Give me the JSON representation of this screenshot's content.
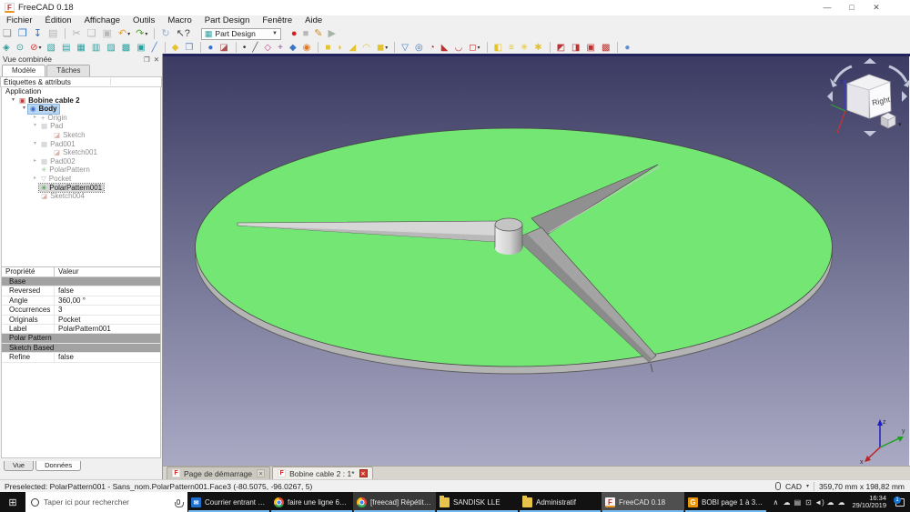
{
  "window": {
    "title": "FreeCAD 0.18",
    "minimize": "—",
    "maximize": "□",
    "close": "✕"
  },
  "menu": [
    "Fichier",
    "Édition",
    "Affichage",
    "Outils",
    "Macro",
    "Part Design",
    "Fenêtre",
    "Aide"
  ],
  "toolbar1": {
    "items": [
      {
        "name": "new-file-button",
        "glyph": "❏",
        "color": "#8a8a8a"
      },
      {
        "name": "open-file-button",
        "glyph": "❒",
        "color": "#3a76c4"
      },
      {
        "name": "save-button",
        "glyph": "↧",
        "color": "#2f6fc0"
      },
      {
        "name": "print-button",
        "glyph": "▤",
        "color": "#b5b5b5"
      },
      {
        "name": "separator",
        "sep": "true",
        "inter": "false"
      },
      {
        "name": "cut-button",
        "glyph": "✂",
        "color": "#b0b0b0"
      },
      {
        "name": "copy-button",
        "glyph": "❑",
        "color": "#b8b8b8"
      },
      {
        "name": "paste-button",
        "glyph": "▣",
        "color": "#b8b8b8"
      },
      {
        "name": "undo-button",
        "glyph": "↶",
        "color": "#e0a030",
        "caret": "▾"
      },
      {
        "name": "redo-button",
        "glyph": "↷",
        "color": "#4fa52f",
        "caret": "▾"
      },
      {
        "name": "separator",
        "sep": "true",
        "inter": "false"
      },
      {
        "name": "refresh-button",
        "glyph": "↻",
        "color": "#9ab0cc"
      },
      {
        "name": "whats-this-button",
        "glyph": "↖?",
        "color": "#444444"
      }
    ],
    "workbench": {
      "icon": "▦",
      "label": "Part Design",
      "caret": "▼"
    },
    "macro_items": [
      {
        "name": "macro-record-button",
        "glyph": "●",
        "color": "#d42020"
      },
      {
        "name": "macro-stop-button",
        "glyph": "■",
        "color": "#b8b8b8"
      },
      {
        "name": "macro-edit-button",
        "glyph": "✎",
        "color": "#d08a28"
      },
      {
        "name": "macro-play-button",
        "glyph": "▶",
        "color": "#a8b4a8"
      }
    ]
  },
  "toolbar2": {
    "items": [
      {
        "name": "fit-all-button",
        "glyph": "◈",
        "color": "#2b9898"
      },
      {
        "name": "zoom-button",
        "glyph": "⊙",
        "color": "#2b9898"
      },
      {
        "name": "draw-style-button",
        "glyph": "⊘",
        "color": "#d03030",
        "caret": "▾"
      },
      {
        "name": "view-isometric-button",
        "glyph": "▧",
        "color": "#2aa0a0"
      },
      {
        "name": "view-front-button",
        "glyph": "▤",
        "color": "#2aa0a0"
      },
      {
        "name": "view-top-button",
        "glyph": "▦",
        "color": "#2aa0a0"
      },
      {
        "name": "view-right-button",
        "glyph": "▥",
        "color": "#2aa0a0"
      },
      {
        "name": "view-rear-button",
        "glyph": "▨",
        "color": "#2aa0a0"
      },
      {
        "name": "view-bottom-button",
        "glyph": "▩",
        "color": "#2aa0a0"
      },
      {
        "name": "view-left-button",
        "glyph": "▣",
        "color": "#2aa0a0"
      },
      {
        "name": "measure-button",
        "glyph": "╱",
        "color": "#3f7fd0"
      },
      {
        "name": "separator",
        "sep": "true",
        "inter": "false"
      },
      {
        "name": "create-part-button",
        "glyph": "◆",
        "color": "#e3c330"
      },
      {
        "name": "create-group-button",
        "glyph": "❒",
        "color": "#6b86b8"
      },
      {
        "name": "separator",
        "sep": "true",
        "inter": "false"
      },
      {
        "name": "create-body-button",
        "glyph": "●",
        "color": "#3a6ed0"
      },
      {
        "name": "create-sketch-button",
        "glyph": "◪",
        "color": "#b05050"
      },
      {
        "name": "separator",
        "sep": "true",
        "inter": "false"
      },
      {
        "name": "datum-point-button",
        "glyph": "•",
        "color": "#333333"
      },
      {
        "name": "datum-line-button",
        "glyph": "╱",
        "color": "#555555"
      },
      {
        "name": "datum-plane-button",
        "glyph": "◇",
        "color": "#c04080"
      },
      {
        "name": "local-cs-button",
        "glyph": "+",
        "color": "#885588"
      },
      {
        "name": "shape-binder-button",
        "glyph": "◆",
        "color": "#3a76c4"
      },
      {
        "name": "clone-button",
        "glyph": "◉",
        "color": "#e07820"
      },
      {
        "name": "separator",
        "sep": "true",
        "inter": "false"
      },
      {
        "name": "pad-button",
        "glyph": "■",
        "color": "#e3c330"
      },
      {
        "name": "revolution-button",
        "glyph": "◗",
        "color": "#e3c330"
      },
      {
        "name": "additive-loft-button",
        "glyph": "◢",
        "color": "#e3c330"
      },
      {
        "name": "additive-pipe-button",
        "glyph": "◠",
        "color": "#e3c330"
      },
      {
        "name": "additive-primitive-button",
        "glyph": "◼",
        "color": "#e3c330",
        "caret": "▾"
      },
      {
        "name": "separator",
        "sep": "true",
        "inter": "false"
      },
      {
        "name": "pocket-button",
        "glyph": "▽",
        "color": "#3a76c4"
      },
      {
        "name": "hole-button",
        "glyph": "◎",
        "color": "#3a76c4"
      },
      {
        "name": "groove-button",
        "glyph": "◔",
        "color": "#c03030"
      },
      {
        "name": "subtractive-loft-button",
        "glyph": "◣",
        "color": "#c03030"
      },
      {
        "name": "subtractive-pipe-button",
        "glyph": "◡",
        "color": "#c03030"
      },
      {
        "name": "subtractive-primitive-button",
        "glyph": "◻",
        "color": "#c03030",
        "caret": "▾"
      },
      {
        "name": "separator",
        "sep": "true",
        "inter": "false"
      },
      {
        "name": "mirrored-button",
        "glyph": "◧",
        "color": "#e3c330"
      },
      {
        "name": "linear-pattern-button",
        "glyph": "≡",
        "color": "#e3c330"
      },
      {
        "name": "polar-pattern-button",
        "glyph": "✳",
        "color": "#e3c330"
      },
      {
        "name": "multitransform-button",
        "glyph": "✱",
        "color": "#e3c330"
      },
      {
        "name": "separator",
        "sep": "true",
        "inter": "false"
      },
      {
        "name": "boolean-union-button",
        "glyph": "◩",
        "color": "#c03030"
      },
      {
        "name": "boolean-cut-button",
        "glyph": "◨",
        "color": "#c03030"
      },
      {
        "name": "boolean-intersect-button",
        "glyph": "▣",
        "color": "#c03030"
      },
      {
        "name": "boolean-compound-button",
        "glyph": "▩",
        "color": "#c03030"
      },
      {
        "name": "separator",
        "sep": "true",
        "inter": "false"
      },
      {
        "name": "migrate-button",
        "glyph": "●",
        "color": "#5f8fd0"
      }
    ]
  },
  "combo_view": {
    "title": "Vue combinée",
    "float_icon": "❐",
    "close_icon": "✕",
    "tabs": [
      {
        "label": "Modèle"
      },
      {
        "label": "Tâches"
      }
    ],
    "tree_header": "Étiquettes & attributs",
    "tree": [
      {
        "label": "Application",
        "icon": "",
        "expander": ""
      },
      {
        "label": "Bobine cable 2",
        "icon": "document-icon",
        "expander": "▾"
      },
      {
        "label": "Body",
        "icon": "body-icon",
        "expander": "▾"
      },
      {
        "label": "Origin",
        "icon": "origin-icon",
        "expander": "▸"
      },
      {
        "label": "Pad",
        "icon": "pad-icon",
        "expander": "▾"
      },
      {
        "label": "Sketch",
        "icon": "sketch-icon",
        "expander": ""
      },
      {
        "label": "Pad001",
        "icon": "pad-icon",
        "expander": "▾"
      },
      {
        "label": "Sketch001",
        "icon": "sketch-icon",
        "expander": ""
      },
      {
        "label": "Pad002",
        "icon": "pad-icon",
        "expander": "▸"
      },
      {
        "label": "PolarPattern",
        "icon": "polarpattern-icon",
        "expander": ""
      },
      {
        "label": "Pocket",
        "icon": "pocket-icon",
        "expander": "▸"
      },
      {
        "label": "PolarPattern001",
        "icon": "polarpattern-icon",
        "expander": ""
      },
      {
        "label": "Sketch004",
        "icon": "sketch-icon",
        "expander": ""
      }
    ],
    "bottom_tabs": [
      {
        "label": "Vue"
      },
      {
        "label": "Données"
      }
    ]
  },
  "properties": {
    "col_property": "Propriété",
    "col_value": "Valeur",
    "rows": [
      {
        "type": "group",
        "name": "Base"
      },
      {
        "name": "Reversed",
        "value": "false"
      },
      {
        "name": "Angle",
        "value": "360,00 °"
      },
      {
        "name": "Occurrences",
        "value": "3"
      },
      {
        "name": "Originals",
        "value": "Pocket"
      },
      {
        "name": "Label",
        "value": "PolarPattern001"
      },
      {
        "type": "group",
        "name": "Polar Pattern"
      },
      {
        "type": "group",
        "name": "Sketch Based"
      },
      {
        "name": "Refine",
        "value": "false"
      }
    ]
  },
  "viewport": {
    "nav_cube": {
      "face_label": "Right",
      "caret": "▾"
    },
    "axes": {
      "x": "x",
      "y": "y",
      "z": "z"
    },
    "colors": {
      "bg_top": "#3b3b63",
      "bg_bottom": "#aaaac5",
      "disc_top": "#74e674",
      "disc_rim": "#b4b4b4",
      "rib_light": "#d6d6d6",
      "rib_mid": "#a4a4a4",
      "rib_dark": "#909090",
      "hub_top": "#c4c4c4"
    }
  },
  "document_tabs": [
    {
      "label": "Page de démarrage",
      "close": "✕"
    },
    {
      "label": "Bobine cable 2 : 1*",
      "close": "✕"
    }
  ],
  "status_bar": {
    "message": "Preselected: PolarPattern001 - Sans_nom.PolarPattern001.Face3 (-80.5075, -96.0267, 5)",
    "nav_style": "CAD",
    "caret": "▾",
    "dimensions": "359,70 mm x 198,82 mm"
  },
  "taskbar": {
    "search_placeholder": "Taper ici pour rechercher",
    "apps": [
      {
        "name": "taskbar-outlook",
        "icon": "outlook-icon",
        "label": "Courrier entrant - R...",
        "open": "true"
      },
      {
        "name": "taskbar-chrome-1",
        "icon": "chrome-icon",
        "label": "faire une ligne 60° f...",
        "open": "true"
      },
      {
        "name": "taskbar-chrome-2",
        "icon": "chrome-icon",
        "label": "[freecad] Répétitio...",
        "open": "true",
        "state": "hover"
      },
      {
        "name": "taskbar-folder-sandisk",
        "icon": "folder-icon",
        "label": "SANDISK LLE",
        "open": "true"
      },
      {
        "name": "taskbar-folder-administratif",
        "icon": "folder-icon",
        "label": "Administratif",
        "open": "true"
      },
      {
        "name": "taskbar-freecad",
        "icon": "freecad-icon",
        "label": "FreeCAD 0.18",
        "open": "true",
        "state": "active"
      },
      {
        "name": "taskbar-bobi",
        "icon": "gdoc-icon",
        "label": "BOBI page 1 à 3 - C...",
        "open": "true"
      }
    ],
    "tray": {
      "icons": [
        {
          "name": "tray-expand-icon",
          "glyph": "∧"
        },
        {
          "name": "tray-cloud-icon",
          "glyph": "☁"
        },
        {
          "name": "tray-battery-icon",
          "glyph": "▤"
        },
        {
          "name": "tray-display-icon",
          "glyph": "⊡"
        },
        {
          "name": "tray-volume-icon",
          "glyph": "◄)"
        },
        {
          "name": "tray-onedrive-icon",
          "glyph": "☁"
        },
        {
          "name": "tray-onedrive2-icon",
          "glyph": "☁"
        }
      ],
      "time": "16:34",
      "date": "29/10/2019",
      "badge": "1"
    }
  }
}
